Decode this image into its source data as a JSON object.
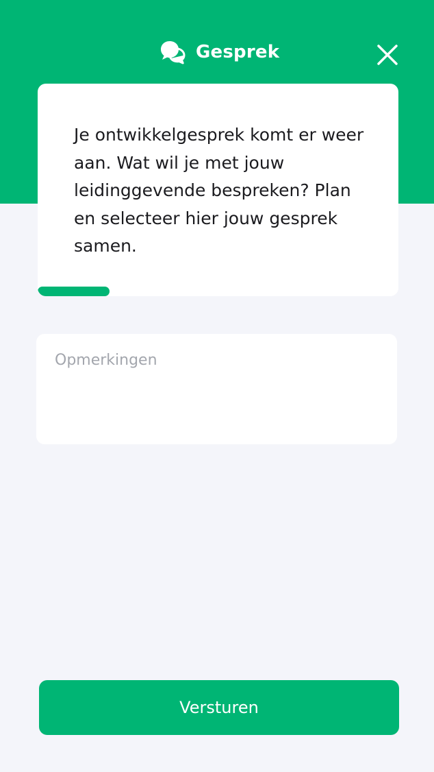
{
  "colors": {
    "accent": "#00b574",
    "background": "#f4f5fa",
    "card": "#ffffff",
    "text": "#1b1b1f",
    "placeholder": "#a3a6ad"
  },
  "header": {
    "icon": "chat-bubbles-icon",
    "title": "Gesprek",
    "close_icon": "close-icon"
  },
  "message_card": {
    "text": "Je ontwikkelgesprek komt er weer aan. Wat wil je met jouw leidinggevende bespreken? Plan en selecteer hier jouw gesprek samen.",
    "progress": 0.2
  },
  "comments": {
    "placeholder": "Opmerkingen",
    "value": ""
  },
  "footer": {
    "send_label": "Versturen"
  }
}
